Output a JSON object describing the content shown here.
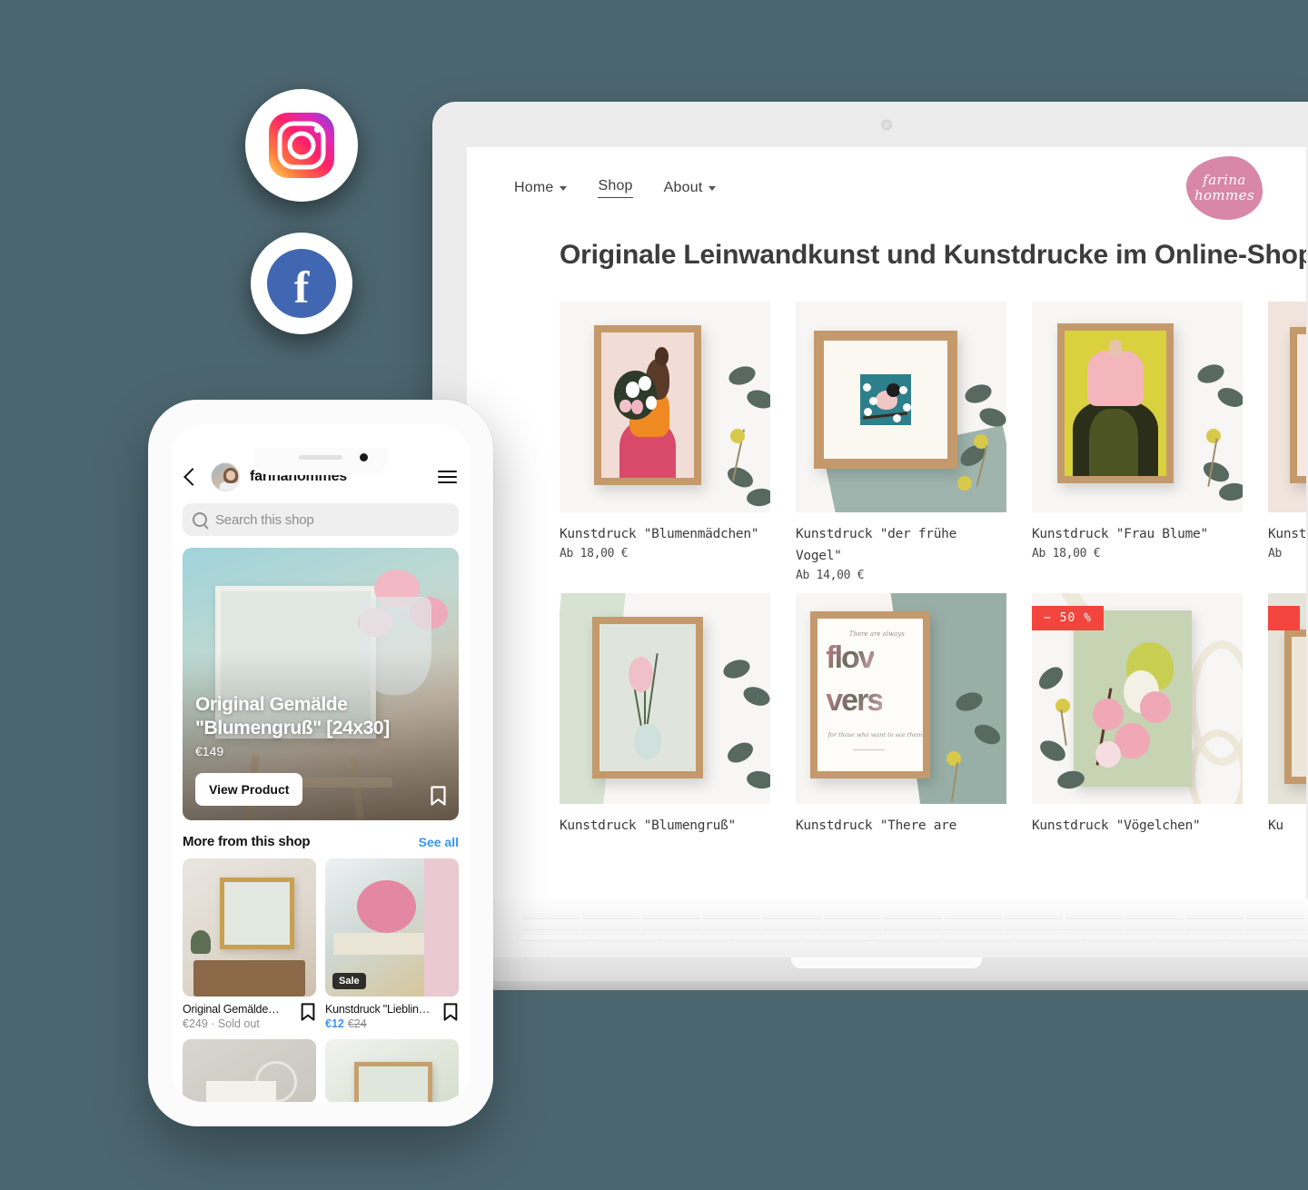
{
  "theme": {
    "background": "#4c6670",
    "accent_pink": "#d887a8",
    "sale_red": "#f2453d",
    "link_blue": "#3897f0"
  },
  "social_icons": [
    {
      "name": "instagram-icon",
      "label": "Instagram"
    },
    {
      "name": "facebook-icon",
      "label": "Facebook",
      "glyph": "f"
    }
  ],
  "desktop": {
    "nav": {
      "items": [
        {
          "label": "Home",
          "has_dropdown": true,
          "active": false
        },
        {
          "label": "Shop",
          "has_dropdown": false,
          "active": true
        },
        {
          "label": "About",
          "has_dropdown": true,
          "active": false
        }
      ]
    },
    "logo": {
      "line1": "farina",
      "line2": "hommes"
    },
    "heading": "Originale Leinwandkunst und Kunstdrucke im Online-Shop",
    "products": [
      {
        "title": "Kunstdruck \"Blumenmädchen\"",
        "price": "Ab 18,00 €",
        "badge": ""
      },
      {
        "title": "Kunstdruck \"der frühe Vogel\"",
        "price": "Ab 14,00 €",
        "badge": ""
      },
      {
        "title": "Kunstdruck \"Frau Blume\"",
        "price": "Ab 18,00 €",
        "badge": ""
      },
      {
        "title": "Kunstdruck \"Ro",
        "price": "Ab",
        "badge": ""
      },
      {
        "title": "Kunstdruck \"Blumengruß\"",
        "price": "",
        "badge": ""
      },
      {
        "title": "Kunstdruck \"There are",
        "price": "",
        "badge": ""
      },
      {
        "title": "Kunstdruck \"Vögelchen\"",
        "price": "",
        "badge": "− 50 %"
      },
      {
        "title": "Ku",
        "price": "",
        "badge": ""
      }
    ]
  },
  "phone": {
    "header": {
      "account": "farinahommes"
    },
    "search": {
      "placeholder": "Search this shop"
    },
    "hero": {
      "title": "Original Gemälde \"Blumengruß\" [24x30]",
      "price": "€149",
      "button": "View Product"
    },
    "more_section": {
      "title": "More from this shop",
      "see_all": "See all"
    },
    "tiles": [
      {
        "name": "Original Gemälde…",
        "price": "€249 · Sold out",
        "badge": ""
      },
      {
        "name": "Kunstdruck \"Lieblin…",
        "price_now": "€12",
        "price_was": "€24",
        "badge": "Sale"
      }
    ]
  }
}
